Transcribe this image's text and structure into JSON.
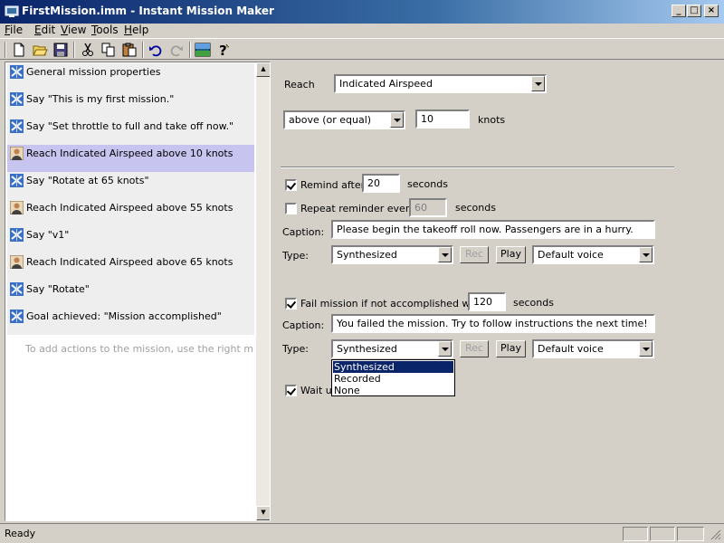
{
  "window": {
    "title": "FirstMission.imm - Instant Mission Maker"
  },
  "menu": [
    {
      "label": "File",
      "key": "F",
      "rest": "ile"
    },
    {
      "label": "Edit",
      "key": "E",
      "rest": "dit"
    },
    {
      "label": "View",
      "key": "V",
      "rest": "iew"
    },
    {
      "label": "Tools",
      "key": "T",
      "rest": "ools"
    },
    {
      "label": "Help",
      "key": "H",
      "rest": "elp"
    }
  ],
  "toolbar": [
    "new-file-icon",
    "open-folder-icon",
    "save-icon",
    "cut-icon",
    "copy-icon",
    "paste-icon",
    "undo-icon",
    "redo-icon",
    "mission-preview-icon",
    "help-icon"
  ],
  "tree": {
    "items": [
      {
        "label": "General mission properties",
        "icon": "plane"
      },
      {
        "label": "Say \"This is my first mission.\"",
        "icon": "plane"
      },
      {
        "label": "Say \"Set throttle to full and take off now.\"",
        "icon": "plane"
      },
      {
        "label": "Reach Indicated Airspeed above 10 knots",
        "icon": "pilot"
      },
      {
        "label": "Say \"Rotate at 65 knots\"",
        "icon": "plane"
      },
      {
        "label": "Reach Indicated Airspeed above 55 knots",
        "icon": "pilot"
      },
      {
        "label": "Say \"v1\"",
        "icon": "plane"
      },
      {
        "label": "Reach Indicated Airspeed above 65 knots",
        "icon": "pilot"
      },
      {
        "label": "Say \"Rotate\"",
        "icon": "plane"
      },
      {
        "label": "Goal achieved: \"Mission accomplished\"",
        "icon": "plane"
      }
    ],
    "selected_index": 3,
    "hint": "To add actions to the mission, use the right mouse button"
  },
  "details": {
    "reach_label": "Reach",
    "reach_value": "Indicated Airspeed",
    "comparison_value": "above (or equal)",
    "threshold_value": "10",
    "threshold_unit": "knots",
    "remind_after_label": "Remind after",
    "remind_after_value": "20",
    "remind_after_unit": "seconds",
    "remind_checked": true,
    "repeat_label": "Repeat reminder every",
    "repeat_value": "60",
    "repeat_unit": "seconds",
    "repeat_checked": false,
    "caption_label": "Caption:",
    "reminder_caption": "Please begin the takeoff roll now. Passengers are in a hurry.",
    "type_label": "Type:",
    "reminder_type": "Synthesized",
    "rec_label": "Rec",
    "play_label": "Play",
    "reminder_voice": "Default voice",
    "fail_label": "Fail mission if not accomplished within",
    "fail_value": "120",
    "fail_unit": "seconds",
    "fail_checked": true,
    "fail_caption": "You failed the mission. Try to follow instructions the next time!",
    "fail_type": "Synthesized",
    "fail_voice": "Default voice",
    "type_options": [
      "Synthesized",
      "Recorded",
      "None"
    ],
    "type_selected_index": 0,
    "wait_label": "Wait u",
    "wait_checked": true
  },
  "status": {
    "text": "Ready"
  },
  "colors": {
    "titlebar": "#0a246a",
    "selected_row": "#c8c4f0",
    "dropdown_highlight": "#0a246a"
  }
}
